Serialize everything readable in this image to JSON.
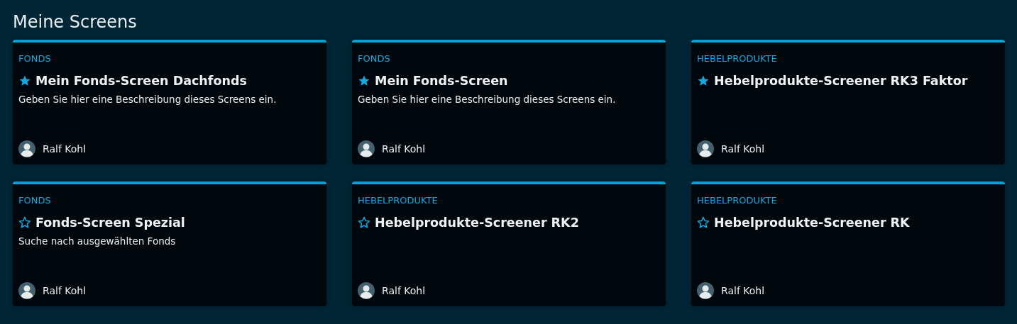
{
  "heading": "Meine Screens",
  "screens": [
    {
      "category": "FONDS",
      "title": "Mein Fonds-Screen Dachfonds",
      "favorite": true,
      "description": "Geben Sie hier eine Beschreibung dieses Screens ein.",
      "author": "Ralf Kohl"
    },
    {
      "category": "FONDS",
      "title": "Mein Fonds-Screen",
      "favorite": true,
      "description": "Geben Sie hier eine Beschreibung dieses Screens ein.",
      "author": "Ralf Kohl"
    },
    {
      "category": "HEBELPRODUKTE",
      "title": "Hebelprodukte-Screener RK3 Faktor",
      "favorite": true,
      "author": "Ralf Kohl"
    },
    {
      "category": "FONDS",
      "title": "Fonds-Screen Spezial",
      "favorite": false,
      "description": "Suche nach ausgewählten Fonds",
      "author": "Ralf Kohl"
    },
    {
      "category": "HEBELPRODUKTE",
      "title": "Hebelprodukte-Screener RK2",
      "favorite": false,
      "author": "Ralf Kohl"
    },
    {
      "category": "HEBELPRODUKTE",
      "title": "Hebelprodukte-Screener RK",
      "favorite": false,
      "author": "Ralf Kohl"
    }
  ]
}
